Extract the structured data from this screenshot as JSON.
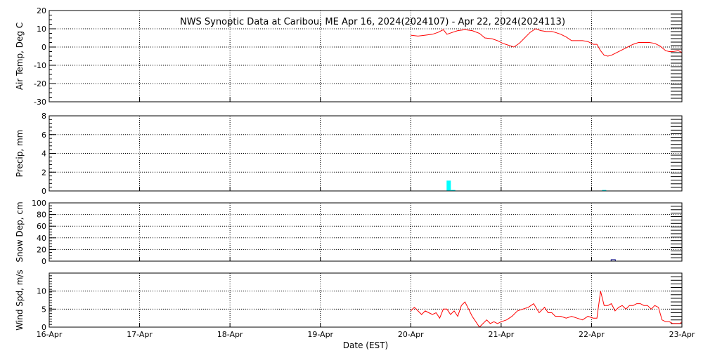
{
  "chart_data": {
    "type": "line",
    "title": "NWS Synoptic Data at Caribou, ME   Apr 16, 2024(2024107) - Apr 22, 2024(2024113)",
    "xlabel": "Date (EST)",
    "x_ticks": [
      "16-Apr",
      "17-Apr",
      "18-Apr",
      "19-Apr",
      "20-Apr",
      "21-Apr",
      "22-Apr",
      "23-Apr"
    ],
    "xlim": [
      0,
      7
    ],
    "grid": true,
    "panels": [
      {
        "id": "air-temp",
        "ylabel": "Air Temp, Deg C",
        "type": "line",
        "color": "#ff0000",
        "ylim": [
          -30,
          20
        ],
        "yticks": [
          20,
          10,
          0,
          -10,
          -20,
          -30
        ],
        "series": [
          {
            "x": [
              4.0,
              4.08,
              4.16,
              4.24,
              4.3,
              4.36,
              4.4,
              4.46,
              4.52,
              4.6,
              4.68,
              4.76,
              4.82,
              4.9,
              4.96,
              5.02,
              5.08,
              5.14,
              5.2,
              5.26,
              5.32,
              5.38,
              5.44,
              5.5,
              5.56,
              5.6,
              5.66,
              5.72,
              5.78,
              5.84,
              5.9,
              5.96,
              6.02,
              6.06,
              6.1,
              6.14,
              6.18,
              6.22,
              6.28,
              6.34,
              6.4,
              6.46,
              6.52,
              6.58,
              6.64,
              6.7,
              6.76,
              6.82,
              6.86,
              6.9,
              6.96,
              7.0
            ],
            "y": [
              6.5,
              6.0,
              6.5,
              7.0,
              8.0,
              9.5,
              7.0,
              8.0,
              9.0,
              9.5,
              9.0,
              7.5,
              5.0,
              4.5,
              3.5,
              2.0,
              1.0,
              0.0,
              2.0,
              5.0,
              8.0,
              10.0,
              9.0,
              8.5,
              8.5,
              8.0,
              7.0,
              5.5,
              3.5,
              3.5,
              3.5,
              3.0,
              1.5,
              1.5,
              -2.0,
              -4.5,
              -5.0,
              -4.5,
              -3.0,
              -1.5,
              0.0,
              1.5,
              2.5,
              2.5,
              2.5,
              2.0,
              0.5,
              -2.0,
              -2.5,
              -2.5,
              -2.0,
              -3.0
            ]
          }
        ]
      },
      {
        "id": "precip",
        "ylabel": "Precip, mm",
        "type": "bar",
        "color": "#00ffff",
        "ylim": [
          0,
          8
        ],
        "yticks": [
          8,
          6,
          4,
          2,
          0
        ],
        "series": [
          {
            "x": [
              4.42,
              4.47,
              6.14
            ],
            "y": [
              1.1,
              0.1,
              0.1
            ]
          }
        ]
      },
      {
        "id": "snow-depth",
        "ylabel": "Snow Dep, cm",
        "type": "bar",
        "color": "#000080",
        "ylim": [
          0,
          100
        ],
        "yticks": [
          100,
          80,
          60,
          40,
          20,
          0
        ],
        "series": [
          {
            "x": [
              6.24
            ],
            "y": [
              2.5
            ]
          }
        ]
      },
      {
        "id": "wind-speed",
        "ylabel": "Wind Spd, m/s",
        "type": "line",
        "color": "#ff0000",
        "ylim": [
          0,
          15
        ],
        "yticks": [
          10,
          5,
          0
        ],
        "series": [
          {
            "x": [
              4.0,
              4.04,
              4.08,
              4.12,
              4.16,
              4.2,
              4.24,
              4.28,
              4.32,
              4.36,
              4.4,
              4.44,
              4.48,
              4.52,
              4.56,
              4.6,
              4.64,
              4.68,
              4.72,
              4.76,
              4.8,
              4.84,
              4.88,
              4.92,
              4.96,
              5.0,
              5.06,
              5.12,
              5.18,
              5.24,
              5.3,
              5.36,
              5.42,
              5.48,
              5.52,
              5.56,
              5.6,
              5.66,
              5.72,
              5.78,
              5.84,
              5.9,
              5.96,
              6.02,
              6.06,
              6.1,
              6.14,
              6.18,
              6.22,
              6.26,
              6.3,
              6.34,
              6.38,
              6.42,
              6.46,
              6.5,
              6.54,
              6.58,
              6.62,
              6.66,
              6.7,
              6.74,
              6.78,
              6.82,
              6.86,
              6.9,
              6.94,
              6.98,
              7.0
            ],
            "y": [
              4.5,
              5.5,
              4.5,
              3.5,
              4.5,
              4.0,
              3.5,
              4.0,
              2.5,
              5.0,
              5.0,
              3.5,
              4.5,
              3.0,
              6.0,
              7.0,
              5.0,
              3.0,
              1.5,
              0.0,
              1.0,
              2.0,
              1.0,
              1.5,
              1.0,
              1.5,
              2.0,
              3.0,
              4.5,
              5.0,
              5.5,
              6.5,
              4.0,
              5.5,
              4.0,
              4.0,
              3.0,
              3.0,
              2.5,
              3.0,
              2.5,
              2.0,
              3.0,
              2.5,
              2.5,
              10.0,
              6.0,
              6.0,
              6.5,
              4.5,
              5.5,
              6.0,
              5.0,
              6.0,
              6.0,
              6.5,
              6.5,
              6.0,
              6.0,
              5.0,
              6.0,
              5.5,
              2.0,
              1.5,
              1.5,
              1.0,
              1.0,
              1.0,
              1.5
            ]
          }
        ]
      }
    ]
  }
}
